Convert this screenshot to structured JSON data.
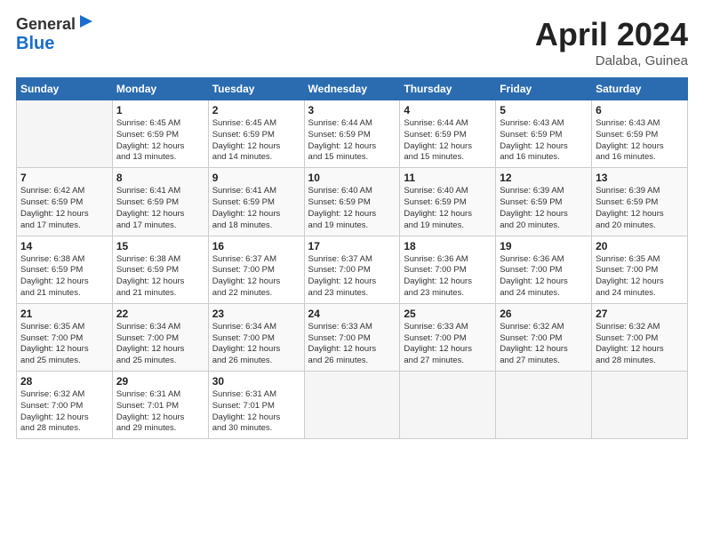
{
  "header": {
    "logo_line1": "General",
    "logo_line2": "Blue",
    "month_title": "April 2024",
    "location": "Dalaba, Guinea"
  },
  "weekdays": [
    "Sunday",
    "Monday",
    "Tuesday",
    "Wednesday",
    "Thursday",
    "Friday",
    "Saturday"
  ],
  "weeks": [
    [
      {
        "day": "",
        "info": ""
      },
      {
        "day": "1",
        "info": "Sunrise: 6:45 AM\nSunset: 6:59 PM\nDaylight: 12 hours\nand 13 minutes."
      },
      {
        "day": "2",
        "info": "Sunrise: 6:45 AM\nSunset: 6:59 PM\nDaylight: 12 hours\nand 14 minutes."
      },
      {
        "day": "3",
        "info": "Sunrise: 6:44 AM\nSunset: 6:59 PM\nDaylight: 12 hours\nand 15 minutes."
      },
      {
        "day": "4",
        "info": "Sunrise: 6:44 AM\nSunset: 6:59 PM\nDaylight: 12 hours\nand 15 minutes."
      },
      {
        "day": "5",
        "info": "Sunrise: 6:43 AM\nSunset: 6:59 PM\nDaylight: 12 hours\nand 16 minutes."
      },
      {
        "day": "6",
        "info": "Sunrise: 6:43 AM\nSunset: 6:59 PM\nDaylight: 12 hours\nand 16 minutes."
      }
    ],
    [
      {
        "day": "7",
        "info": "Sunrise: 6:42 AM\nSunset: 6:59 PM\nDaylight: 12 hours\nand 17 minutes."
      },
      {
        "day": "8",
        "info": "Sunrise: 6:41 AM\nSunset: 6:59 PM\nDaylight: 12 hours\nand 17 minutes."
      },
      {
        "day": "9",
        "info": "Sunrise: 6:41 AM\nSunset: 6:59 PM\nDaylight: 12 hours\nand 18 minutes."
      },
      {
        "day": "10",
        "info": "Sunrise: 6:40 AM\nSunset: 6:59 PM\nDaylight: 12 hours\nand 19 minutes."
      },
      {
        "day": "11",
        "info": "Sunrise: 6:40 AM\nSunset: 6:59 PM\nDaylight: 12 hours\nand 19 minutes."
      },
      {
        "day": "12",
        "info": "Sunrise: 6:39 AM\nSunset: 6:59 PM\nDaylight: 12 hours\nand 20 minutes."
      },
      {
        "day": "13",
        "info": "Sunrise: 6:39 AM\nSunset: 6:59 PM\nDaylight: 12 hours\nand 20 minutes."
      }
    ],
    [
      {
        "day": "14",
        "info": "Sunrise: 6:38 AM\nSunset: 6:59 PM\nDaylight: 12 hours\nand 21 minutes."
      },
      {
        "day": "15",
        "info": "Sunrise: 6:38 AM\nSunset: 6:59 PM\nDaylight: 12 hours\nand 21 minutes."
      },
      {
        "day": "16",
        "info": "Sunrise: 6:37 AM\nSunset: 7:00 PM\nDaylight: 12 hours\nand 22 minutes."
      },
      {
        "day": "17",
        "info": "Sunrise: 6:37 AM\nSunset: 7:00 PM\nDaylight: 12 hours\nand 23 minutes."
      },
      {
        "day": "18",
        "info": "Sunrise: 6:36 AM\nSunset: 7:00 PM\nDaylight: 12 hours\nand 23 minutes."
      },
      {
        "day": "19",
        "info": "Sunrise: 6:36 AM\nSunset: 7:00 PM\nDaylight: 12 hours\nand 24 minutes."
      },
      {
        "day": "20",
        "info": "Sunrise: 6:35 AM\nSunset: 7:00 PM\nDaylight: 12 hours\nand 24 minutes."
      }
    ],
    [
      {
        "day": "21",
        "info": "Sunrise: 6:35 AM\nSunset: 7:00 PM\nDaylight: 12 hours\nand 25 minutes."
      },
      {
        "day": "22",
        "info": "Sunrise: 6:34 AM\nSunset: 7:00 PM\nDaylight: 12 hours\nand 25 minutes."
      },
      {
        "day": "23",
        "info": "Sunrise: 6:34 AM\nSunset: 7:00 PM\nDaylight: 12 hours\nand 26 minutes."
      },
      {
        "day": "24",
        "info": "Sunrise: 6:33 AM\nSunset: 7:00 PM\nDaylight: 12 hours\nand 26 minutes."
      },
      {
        "day": "25",
        "info": "Sunrise: 6:33 AM\nSunset: 7:00 PM\nDaylight: 12 hours\nand 27 minutes."
      },
      {
        "day": "26",
        "info": "Sunrise: 6:32 AM\nSunset: 7:00 PM\nDaylight: 12 hours\nand 27 minutes."
      },
      {
        "day": "27",
        "info": "Sunrise: 6:32 AM\nSunset: 7:00 PM\nDaylight: 12 hours\nand 28 minutes."
      }
    ],
    [
      {
        "day": "28",
        "info": "Sunrise: 6:32 AM\nSunset: 7:00 PM\nDaylight: 12 hours\nand 28 minutes."
      },
      {
        "day": "29",
        "info": "Sunrise: 6:31 AM\nSunset: 7:01 PM\nDaylight: 12 hours\nand 29 minutes."
      },
      {
        "day": "30",
        "info": "Sunrise: 6:31 AM\nSunset: 7:01 PM\nDaylight: 12 hours\nand 30 minutes."
      },
      {
        "day": "",
        "info": ""
      },
      {
        "day": "",
        "info": ""
      },
      {
        "day": "",
        "info": ""
      },
      {
        "day": "",
        "info": ""
      }
    ]
  ]
}
